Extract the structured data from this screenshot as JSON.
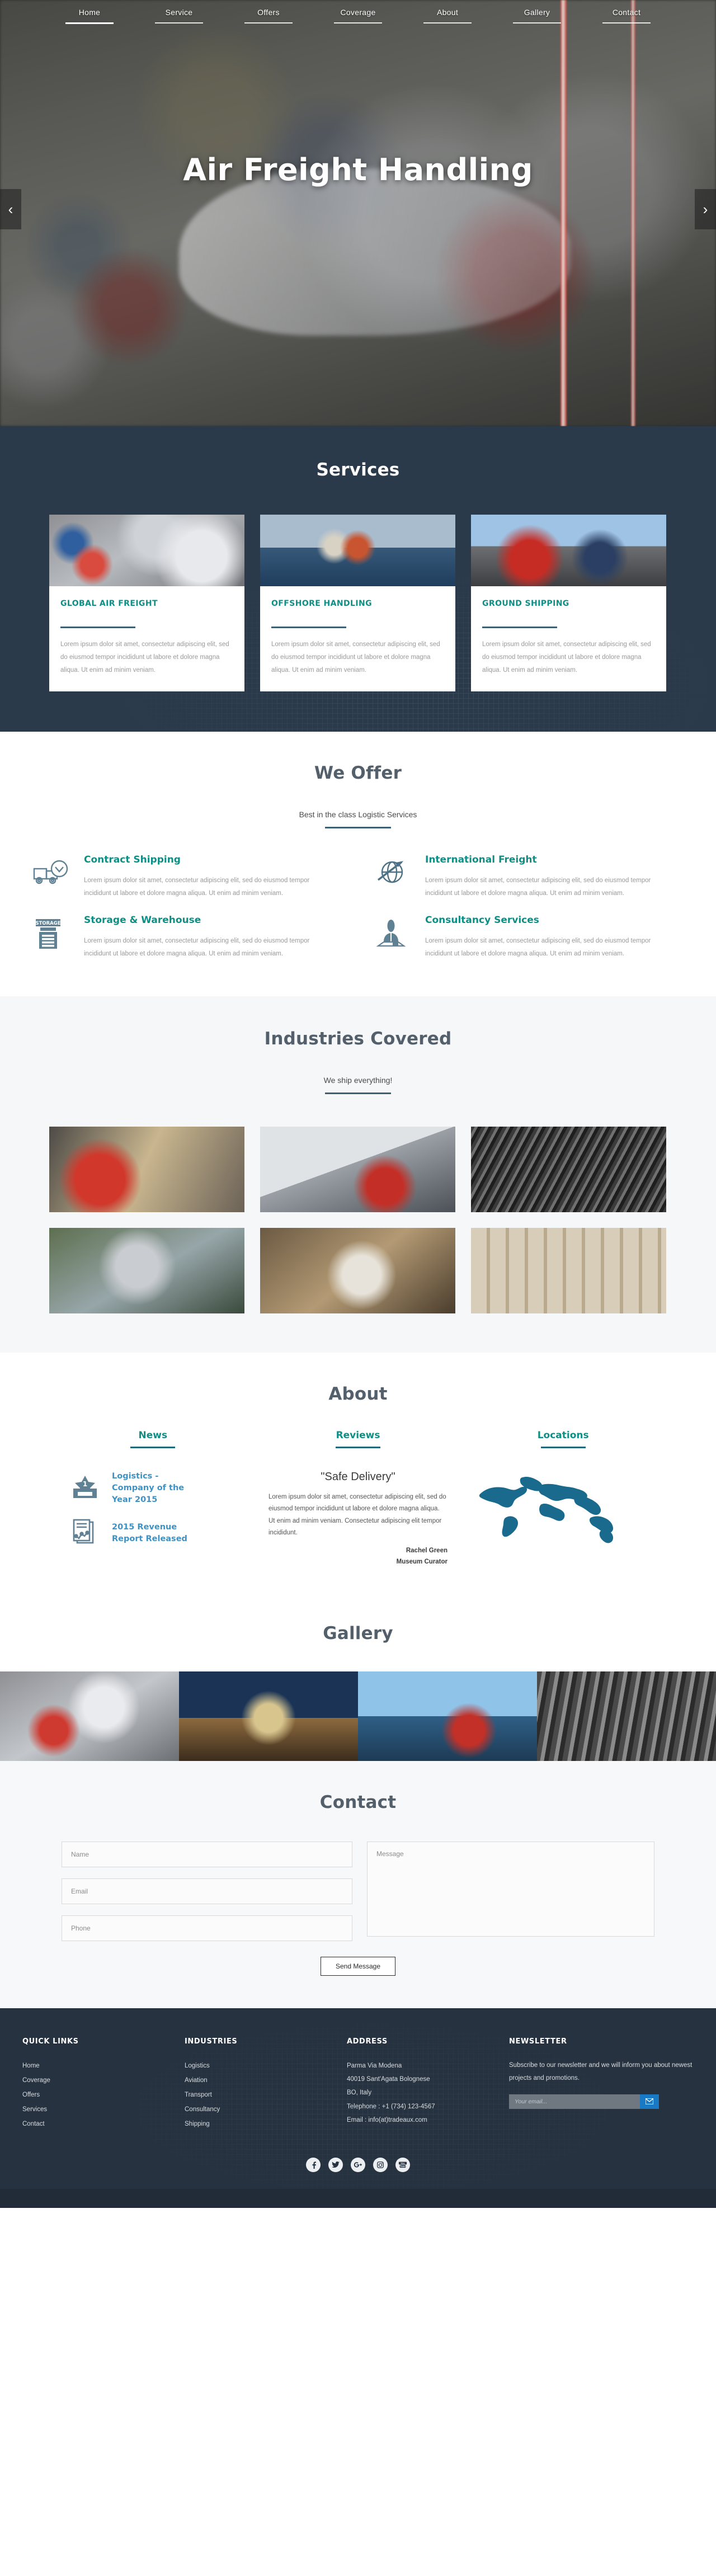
{
  "nav": {
    "items": [
      {
        "label": "Home",
        "active": true
      },
      {
        "label": "Service",
        "active": false
      },
      {
        "label": "Offers",
        "active": false
      },
      {
        "label": "Coverage",
        "active": false
      },
      {
        "label": "About",
        "active": false
      },
      {
        "label": "Gallery",
        "active": false
      },
      {
        "label": "Contact",
        "active": false
      }
    ]
  },
  "hero": {
    "title": "Air Freight Handling",
    "prev_icon": "chevron-left-icon",
    "next_icon": "chevron-right-icon",
    "prev_glyph": "‹",
    "next_glyph": "›"
  },
  "services": {
    "title": "Services",
    "cards": [
      {
        "name": "GLOBAL AIR FREIGHT",
        "text": "Lorem ipsum dolor sit amet, consectetur adipiscing elit, sed do eiusmod tempor incididunt ut labore et dolore magna aliqua. Ut enim ad minim veniam."
      },
      {
        "name": "OFFSHORE HANDLING",
        "text": "Lorem ipsum dolor sit amet, consectetur adipiscing elit, sed do eiusmod tempor incididunt ut labore et dolore magna aliqua. Ut enim ad minim veniam."
      },
      {
        "name": "GROUND SHIPPING",
        "text": "Lorem ipsum dolor sit amet, consectetur adipiscing elit, sed do eiusmod tempor incididunt ut labore et dolore magna aliqua. Ut enim ad minim veniam."
      }
    ]
  },
  "offers": {
    "title": "We Offer",
    "subtitle": "Best in the class Logistic Services",
    "items": [
      {
        "icon": "delivery-truck-clock-icon",
        "name": "Contract Shipping",
        "text": "Lorem ipsum dolor sit amet, consectetur adipiscing elit, sed do eiusmod tempor incididunt ut labore et dolore magna aliqua. Ut enim ad minim veniam."
      },
      {
        "icon": "globe-airplane-icon",
        "name": "International Freight",
        "text": "Lorem ipsum dolor sit amet, consectetur adipiscing elit, sed do eiusmod tempor incididunt ut labore et dolore magna aliqua. Ut enim ad minim veniam."
      },
      {
        "icon": "storage-warehouse-icon",
        "name": "Storage & Warehouse",
        "text": "Lorem ipsum dolor sit amet, consectetur adipiscing elit, sed do eiusmod tempor incididunt ut labore et dolore magna aliqua. Ut enim ad minim veniam."
      },
      {
        "icon": "consultant-person-icon",
        "name": "Consultancy Services",
        "text": "Lorem ipsum dolor sit amet, consectetur adipiscing elit, sed do eiusmod tempor incididunt ut labore et dolore magna aliqua. Ut enim ad minim veniam."
      }
    ]
  },
  "industries": {
    "title": "Industries Covered",
    "subtitle": "We ship everything!"
  },
  "about": {
    "title": "About",
    "tabs": [
      {
        "label": "News"
      },
      {
        "label": "Reviews"
      },
      {
        "label": "Locations"
      }
    ],
    "news": [
      {
        "icon": "award-trophy-icon",
        "link": "Logistics - Company of the Year 2015"
      },
      {
        "icon": "report-document-icon",
        "link": "2015 Revenue Report Released"
      }
    ],
    "review": {
      "title": "\"Safe Delivery\"",
      "text": "Lorem ipsum dolor sit amet, consectetur adipiscing elit, sed do eiusmod tempor incididunt ut labore et dolore magna aliqua. Ut enim ad minim veniam. Consectetur adipiscing elit tempor incididunt.",
      "author": "Rachel Green",
      "author_role": "Museum Curator"
    },
    "locations": {
      "icon": "world-map-icon"
    }
  },
  "gallery": {
    "title": "Gallery"
  },
  "contact": {
    "title": "Contact",
    "name_placeholder": "Name",
    "email_placeholder": "Email",
    "phone_placeholder": "Phone",
    "message_placeholder": "Message",
    "send_label": "Send Message"
  },
  "footer": {
    "quick_links": {
      "head": "QUICK LINKS",
      "items": [
        "Home",
        "Coverage",
        "Offers",
        "Services",
        "Contact"
      ]
    },
    "industries": {
      "head": "INDUSTRIES",
      "items": [
        "Logistics",
        "Aviation",
        "Transport",
        "Consultancy",
        "Shipping"
      ]
    },
    "address": {
      "head": "ADDRESS",
      "lines": [
        "Parma Via Modena",
        "40019 Sant'Agata Bolognese",
        "BO, Italy",
        "Telephone : +1 (734) 123-4567",
        "Email : info(at)tradeaux.com"
      ]
    },
    "newsletter": {
      "head": "NEWSLETTER",
      "text": "Subscribe to our newsletter and we will inform you about newest projects and promotions.",
      "placeholder": "Your email...",
      "submit_icon": "envelope-icon"
    },
    "social": [
      {
        "icon": "facebook-icon"
      },
      {
        "icon": "twitter-icon"
      },
      {
        "icon": "google-plus-icon"
      },
      {
        "icon": "instagram-icon"
      },
      {
        "icon": "youtube-icon"
      }
    ]
  },
  "colors": {
    "teal": "#0e8f86",
    "dark_blue": "#2b3a4a",
    "footer_blue": "#26323f",
    "link_blue": "#3e92c4",
    "rule": "#3d6172",
    "accent_button": "#1a79c4"
  }
}
